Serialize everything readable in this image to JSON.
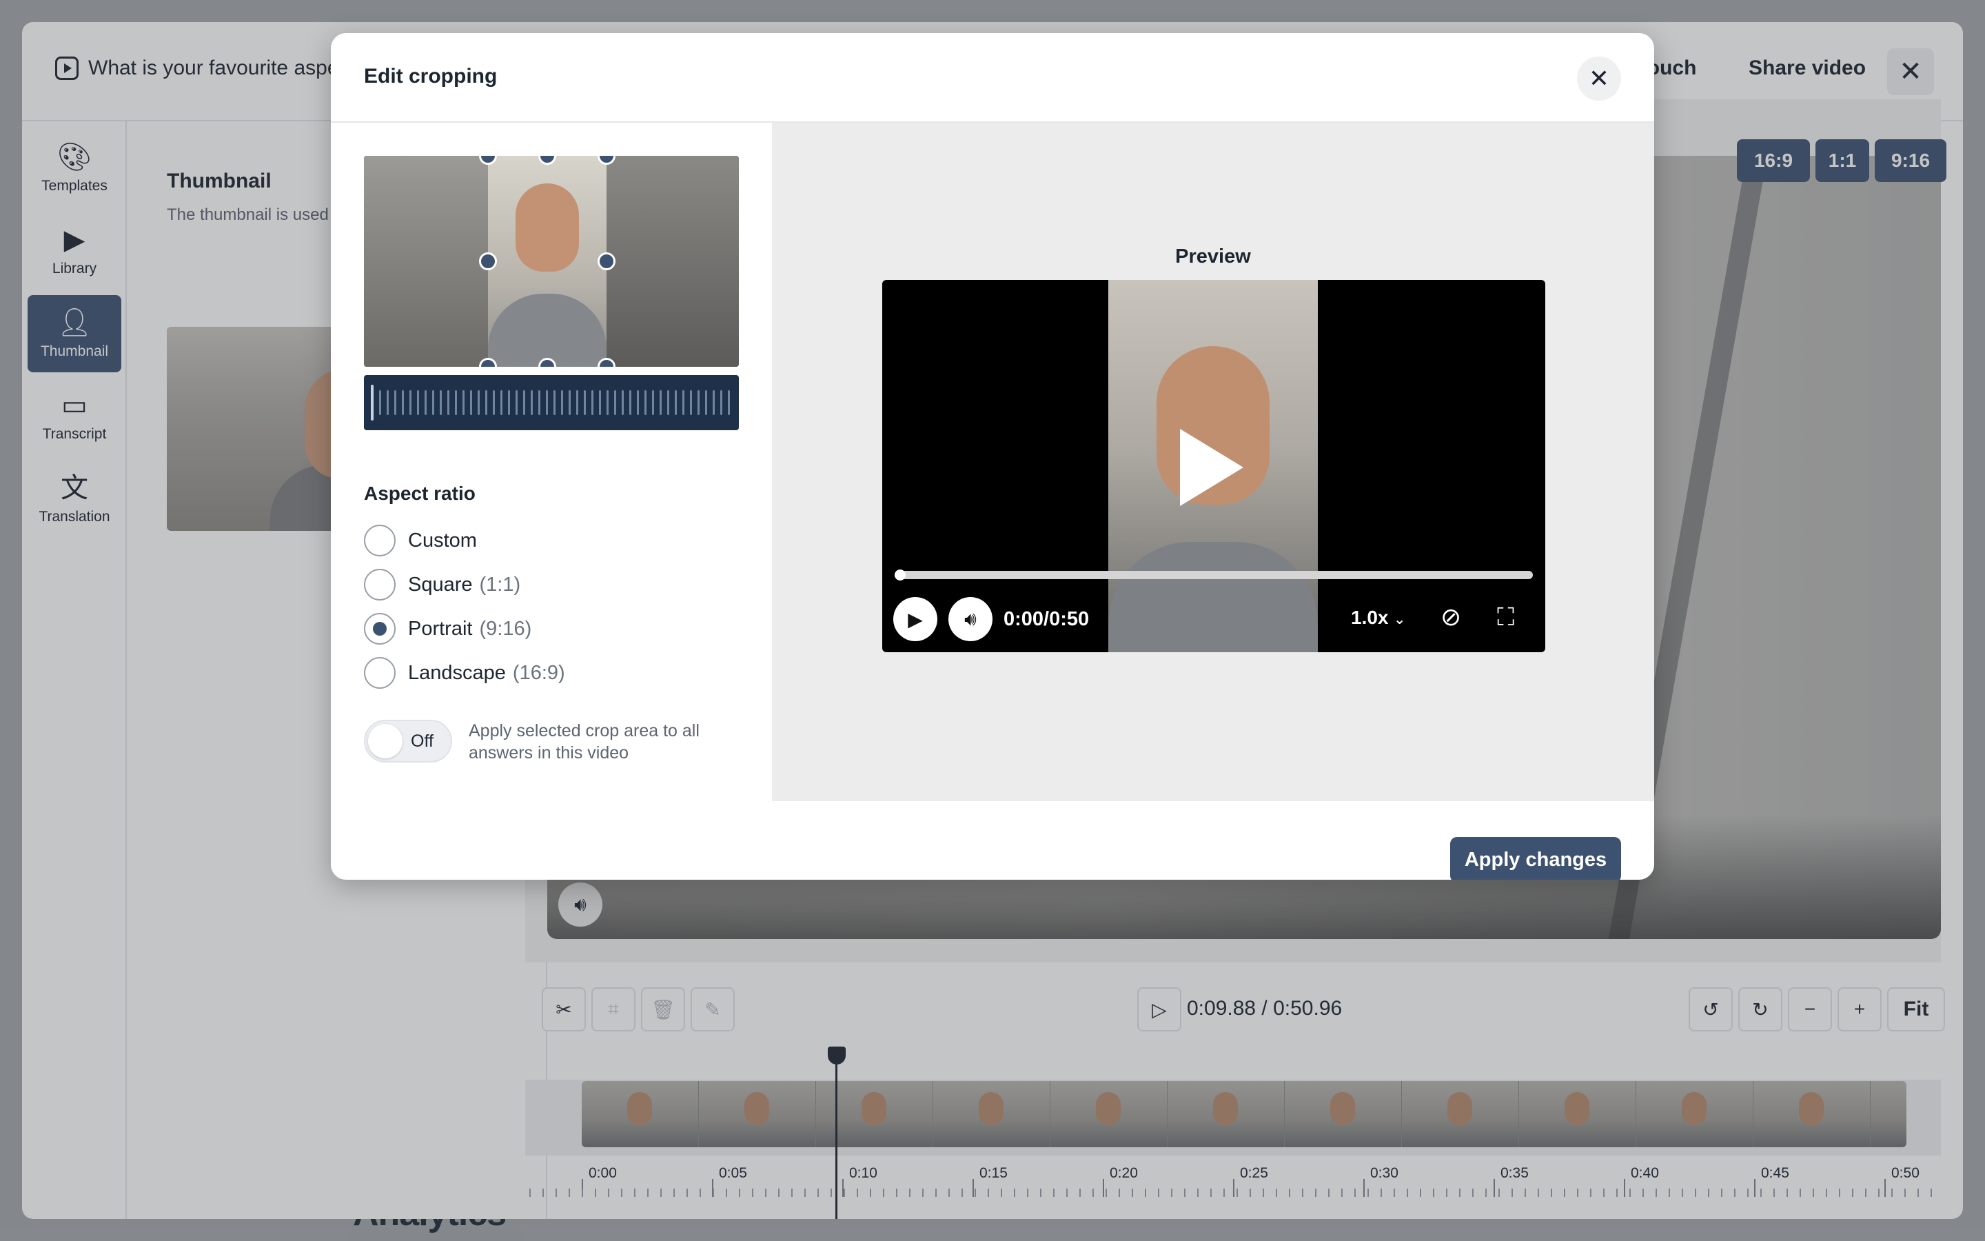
{
  "background": {
    "heading": "Analytics"
  },
  "editor": {
    "title": "What is your favourite aspe",
    "header_buttons": {
      "vouch": "Vouch",
      "share": "Share video"
    },
    "close_icon": "close-icon"
  },
  "nav": {
    "items": [
      {
        "label": "Templates",
        "icon": "palette-icon",
        "active": false
      },
      {
        "label": "Library",
        "icon": "library-icon",
        "active": false
      },
      {
        "label": "Thumbnail",
        "icon": "thumbnail-icon",
        "active": true
      },
      {
        "label": "Transcript",
        "icon": "transcript-icon",
        "active": false
      },
      {
        "label": "Translation",
        "icon": "translation-icon",
        "active": false
      }
    ]
  },
  "thumbnail_panel": {
    "title": "Thumbnail",
    "description": "The thumbnail is used a video player and when s"
  },
  "video_aspect_buttons": [
    "16:9",
    "1:1",
    "9:16"
  ],
  "timeline": {
    "timecode": "0:09.88 / 0:50.96",
    "fit_label": "Fit",
    "ruler_labels": [
      "0:00",
      "0:05",
      "0:10",
      "0:15",
      "0:20",
      "0:25",
      "0:30",
      "0:35",
      "0:40",
      "0:45",
      "0:50"
    ],
    "tools": [
      "scissors-icon",
      "crop-icon",
      "trash-icon",
      "pencil-icon"
    ],
    "controls": [
      "undo-icon",
      "redo-icon",
      "zoom-out-icon",
      "zoom-in-icon"
    ]
  },
  "modal": {
    "title": "Edit cropping",
    "aspect_ratio_title": "Aspect ratio",
    "options": [
      {
        "label": "Custom",
        "sub": "",
        "checked": false
      },
      {
        "label": "Square",
        "sub": "(1:1)",
        "checked": false
      },
      {
        "label": "Portrait",
        "sub": "(9:16)",
        "checked": true
      },
      {
        "label": "Landscape",
        "sub": "(16:9)",
        "checked": false
      }
    ],
    "toggle": {
      "state_label": "Off",
      "description": "Apply selected crop area to all answers in this video"
    },
    "preview": {
      "title": "Preview",
      "time": "0:00/0:50",
      "speed": "1.0x",
      "progress": 0
    },
    "apply_label": "Apply changes"
  }
}
